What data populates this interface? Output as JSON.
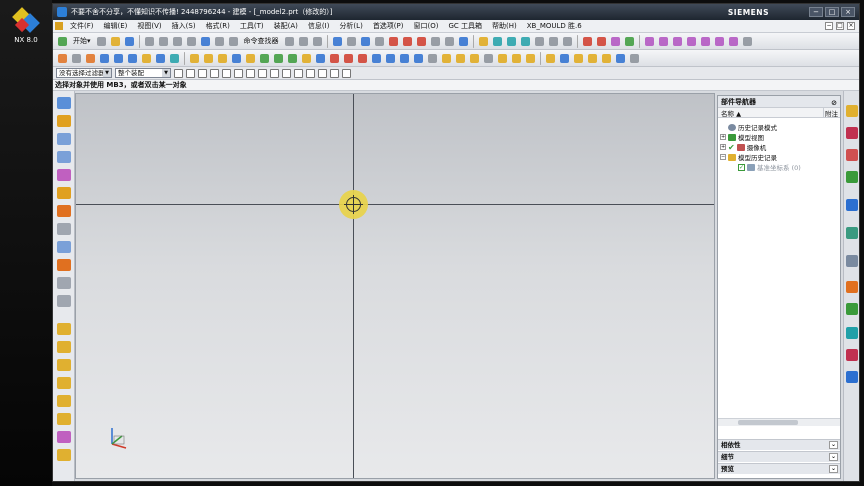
{
  "desktop": {
    "icon_label": "NX 8.0"
  },
  "window": {
    "title": "不要不舍不分享，不懂知识不传播! 2448796244 - 建模 - [_model2.prt（修改的）]",
    "brand": "SIEMENS",
    "buttons": [
      "−",
      "□",
      "×"
    ]
  },
  "menu": [
    "文件(F)",
    "编辑(E)",
    "视图(V)",
    "插入(S)",
    "格式(R)",
    "工具(T)",
    "装配(A)",
    "信息(I)",
    "分析(L)",
    "首选项(P)",
    "窗口(O)",
    "GC 工具箱",
    "帮助(H)",
    "XB_MOULD 胜.6"
  ],
  "toolbar": {
    "start_label": "开始▾",
    "command_finder_label": "命令查找器"
  },
  "filter": {
    "type_filter": "没有选择过滤器",
    "assembly_filter": "整个装配"
  },
  "cue": "选择对象并使用 MB3，或者双击某一对象",
  "navigator": {
    "title": "部件导航器",
    "col_name": "名称 ▲",
    "col_attach": "附注",
    "nodes": [
      {
        "label": "历史记录模式",
        "indent": 0,
        "expander": "",
        "dim": false
      },
      {
        "label": "模型视图",
        "indent": 0,
        "expander": "+",
        "dim": false
      },
      {
        "label": "摄像机",
        "indent": 0,
        "expander": "+",
        "dim": false
      },
      {
        "label": "模型历史记录",
        "indent": 0,
        "expander": "−",
        "dim": false
      },
      {
        "label": "基准坐标系 (0)",
        "indent": 1,
        "expander": "",
        "dim": true
      }
    ],
    "panels": [
      "相依性",
      "细节",
      "预览"
    ]
  },
  "colors": {
    "viewport_top": "#bfc2c7",
    "viewport_bottom": "#e8e9eb",
    "cursor_highlight": "#e8d24a",
    "titlebar": "#1e2630"
  }
}
